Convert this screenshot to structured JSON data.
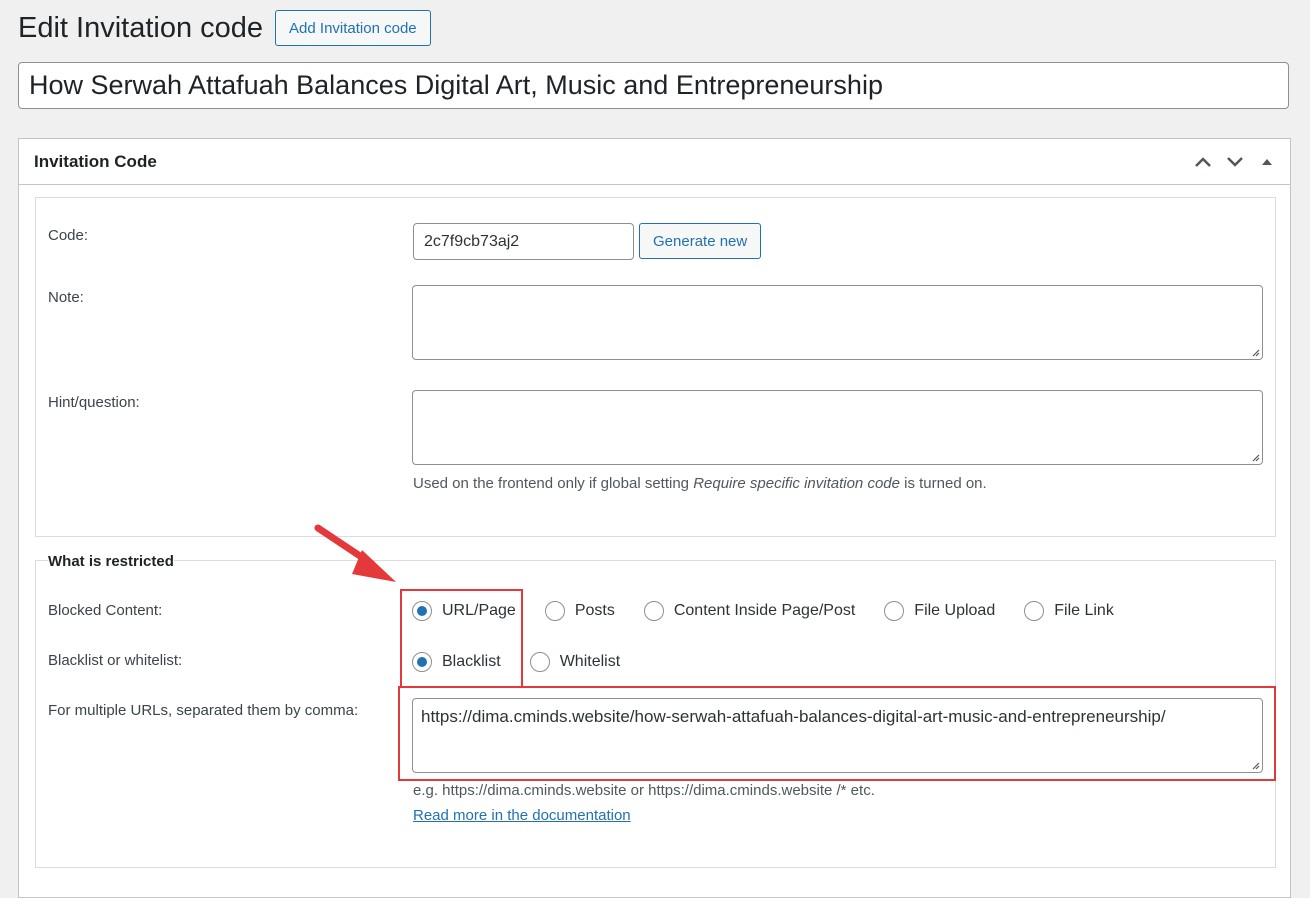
{
  "page": {
    "title": "Edit Invitation code",
    "add_button": "Add Invitation code"
  },
  "post_title": "How Serwah Attafuah Balances Digital Art, Music and Entrepreneurship",
  "metabox": {
    "title": "Invitation Code",
    "icons": [
      "chevron-up-icon",
      "chevron-down-icon",
      "triangle-up-icon"
    ]
  },
  "details": {
    "code_label": "Code:",
    "code_value": "2c7f9cb73aj2",
    "generate_button": "Generate new",
    "note_label": "Note:",
    "note_value": "",
    "hint_label": "Hint/question:",
    "hint_value": "",
    "hint_desc_before": "Used on the frontend only if global setting ",
    "hint_desc_em": "Require specific invitation code",
    "hint_desc_after": " is turned on."
  },
  "restriction": {
    "section_title": "What is restricted",
    "blocked_label": "Blocked Content:",
    "blocked_options": [
      {
        "label": "URL/Page",
        "checked": true
      },
      {
        "label": "Posts",
        "checked": false
      },
      {
        "label": "Content Inside Page/Post",
        "checked": false
      },
      {
        "label": "File Upload",
        "checked": false
      },
      {
        "label": "File Link",
        "checked": false
      }
    ],
    "list_label": "Blacklist or whitelist:",
    "list_options": [
      {
        "label": "Blacklist",
        "checked": true
      },
      {
        "label": "Whitelist",
        "checked": false
      }
    ],
    "urls_label": "For multiple URLs, separated them by comma:",
    "urls_value": "https://dima.cminds.website/how-serwah-attafuah-balances-digital-art-music-and-entrepreneurship/",
    "urls_example": "e.g. https://dima.cminds.website or https://dima.cminds.website /* etc.",
    "doc_link": "Read more in the documentation"
  },
  "annotation_color": "#e5383b",
  "accent_color": "#2271b1"
}
